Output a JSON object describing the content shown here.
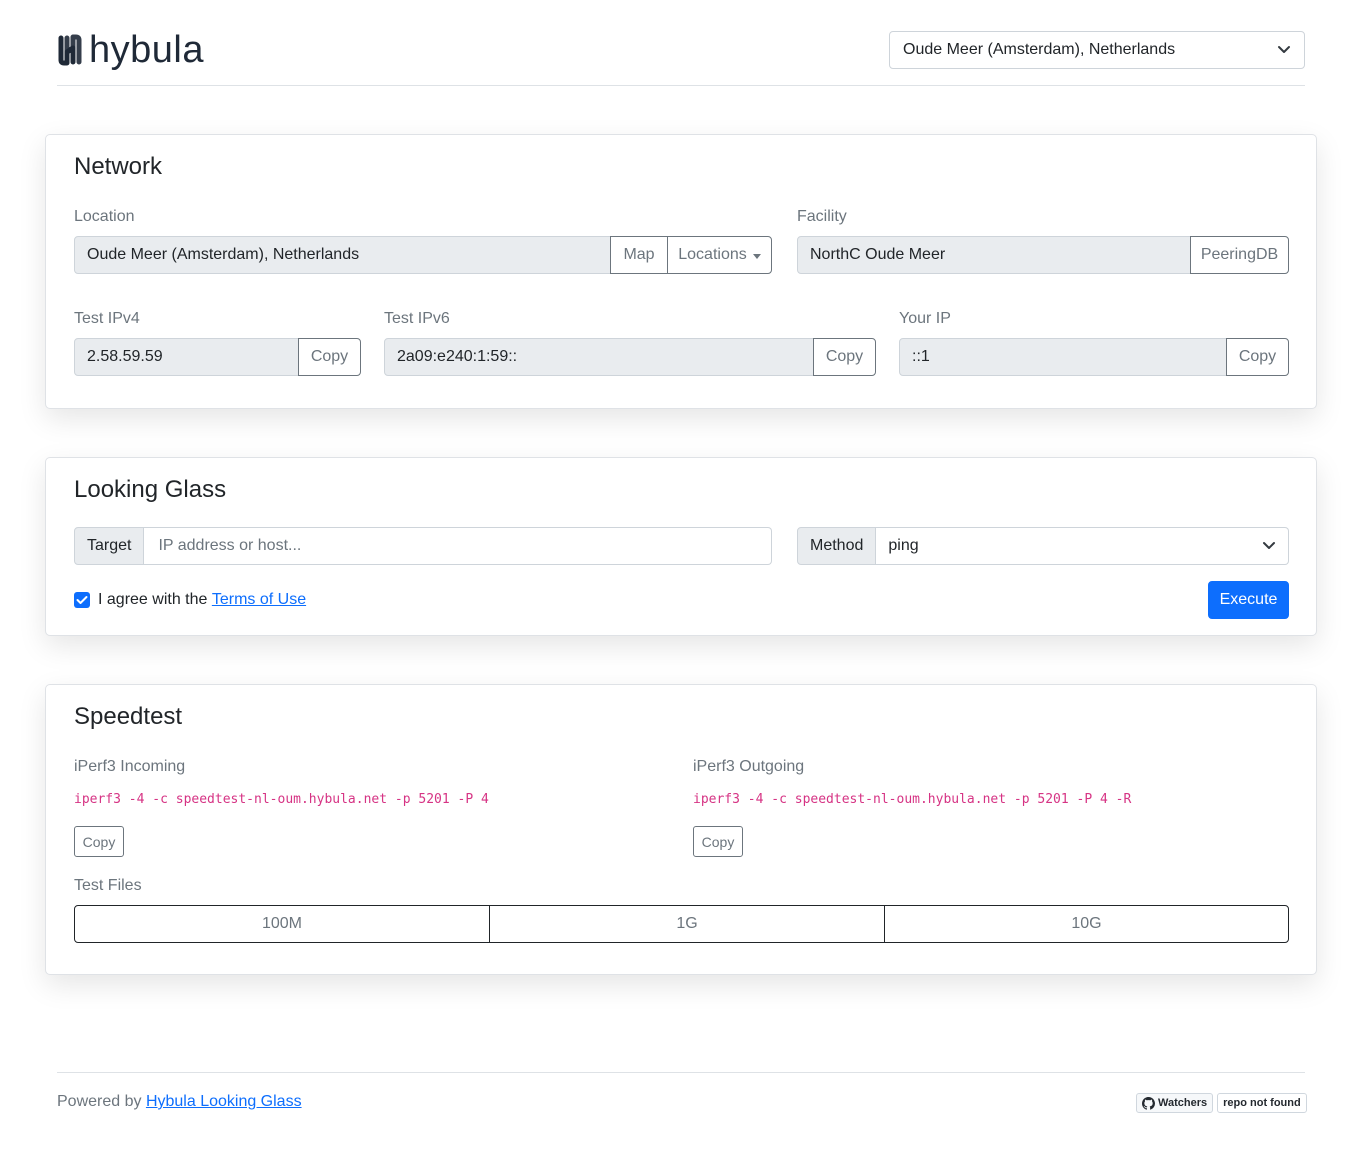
{
  "header": {
    "logo_text": "hybula",
    "location_select": "Oude Meer (Amsterdam), Netherlands"
  },
  "network": {
    "title": "Network",
    "location_label": "Location",
    "location_value": "Oude Meer (Amsterdam), Netherlands",
    "map_button": "Map",
    "locations_button": "Locations",
    "facility_label": "Facility",
    "facility_value": "NorthC Oude Meer",
    "peeringdb_button": "PeeringDB",
    "ipv4_label": "Test IPv4",
    "ipv4_value": "2.58.59.59",
    "ipv6_label": "Test IPv6",
    "ipv6_value": "2a09:e240:1:59::",
    "your_ip_label": "Your IP",
    "your_ip_value": "::1",
    "copy_label": "Copy"
  },
  "looking_glass": {
    "title": "Looking Glass",
    "target_label": "Target",
    "target_placeholder": "IP address or host...",
    "method_label": "Method",
    "method_value": "ping",
    "agree_text": "I agree with the ",
    "terms_link": "Terms of Use",
    "agree_checked": true,
    "execute_button": "Execute"
  },
  "speedtest": {
    "title": "Speedtest",
    "incoming_label": "iPerf3 Incoming",
    "incoming_cmd": "iperf3 -4 -c speedtest-nl-oum.hybula.net -p 5201 -P 4",
    "outgoing_label": "iPerf3 Outgoing",
    "outgoing_cmd": "iperf3 -4 -c speedtest-nl-oum.hybula.net -p 5201 -P 4 -R",
    "copy_label": "Copy",
    "test_files_label": "Test Files",
    "files": [
      "100M",
      "1G",
      "10G"
    ]
  },
  "footer": {
    "powered_by": "Powered by ",
    "powered_link": "Hybula Looking Glass",
    "badge_watchers": "Watchers",
    "badge_status": "repo not found"
  },
  "colors": {
    "primary": "#0d6efd",
    "code": "#d63384",
    "muted": "#6c757d"
  }
}
